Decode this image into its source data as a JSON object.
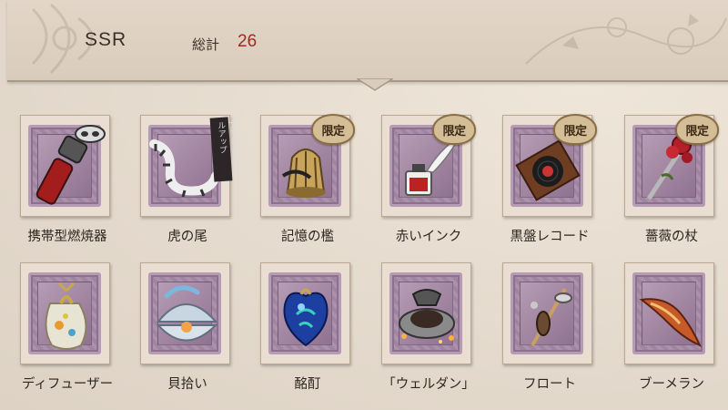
{
  "header": {
    "rarity": "SSR",
    "total_label": "総計",
    "total_value": "26"
  },
  "limited_badge_text": "限定",
  "colors": {
    "accent_red": "#9e2a22",
    "stamp_purple": "#a68aa6",
    "background": "#e6dccf"
  },
  "items": [
    {
      "name": "携帯型燃焼器",
      "limited": false,
      "icon": "portable-burner-icon"
    },
    {
      "name": "虎の尾",
      "limited": false,
      "icon": "tiger-tail-icon",
      "tag": "文学はスキレベルアップ"
    },
    {
      "name": "記憶の檻",
      "limited": true,
      "icon": "memory-cage-icon"
    },
    {
      "name": "赤いインク",
      "limited": true,
      "icon": "red-ink-icon"
    },
    {
      "name": "黒盤レコード",
      "limited": true,
      "icon": "black-record-icon"
    },
    {
      "name": "薔薇の杖",
      "limited": true,
      "icon": "rose-staff-icon"
    },
    {
      "name": "ディフューザー",
      "limited": false,
      "icon": "diffuser-icon"
    },
    {
      "name": "貝拾い",
      "limited": false,
      "icon": "shell-icon"
    },
    {
      "name": "酩酊",
      "limited": false,
      "icon": "intoxication-heart-icon"
    },
    {
      "name": "「ウェルダン」",
      "limited": false,
      "icon": "welldone-icon"
    },
    {
      "name": "フロート",
      "limited": false,
      "icon": "float-icon"
    },
    {
      "name": "ブーメラン",
      "limited": false,
      "icon": "boomerang-icon"
    }
  ]
}
